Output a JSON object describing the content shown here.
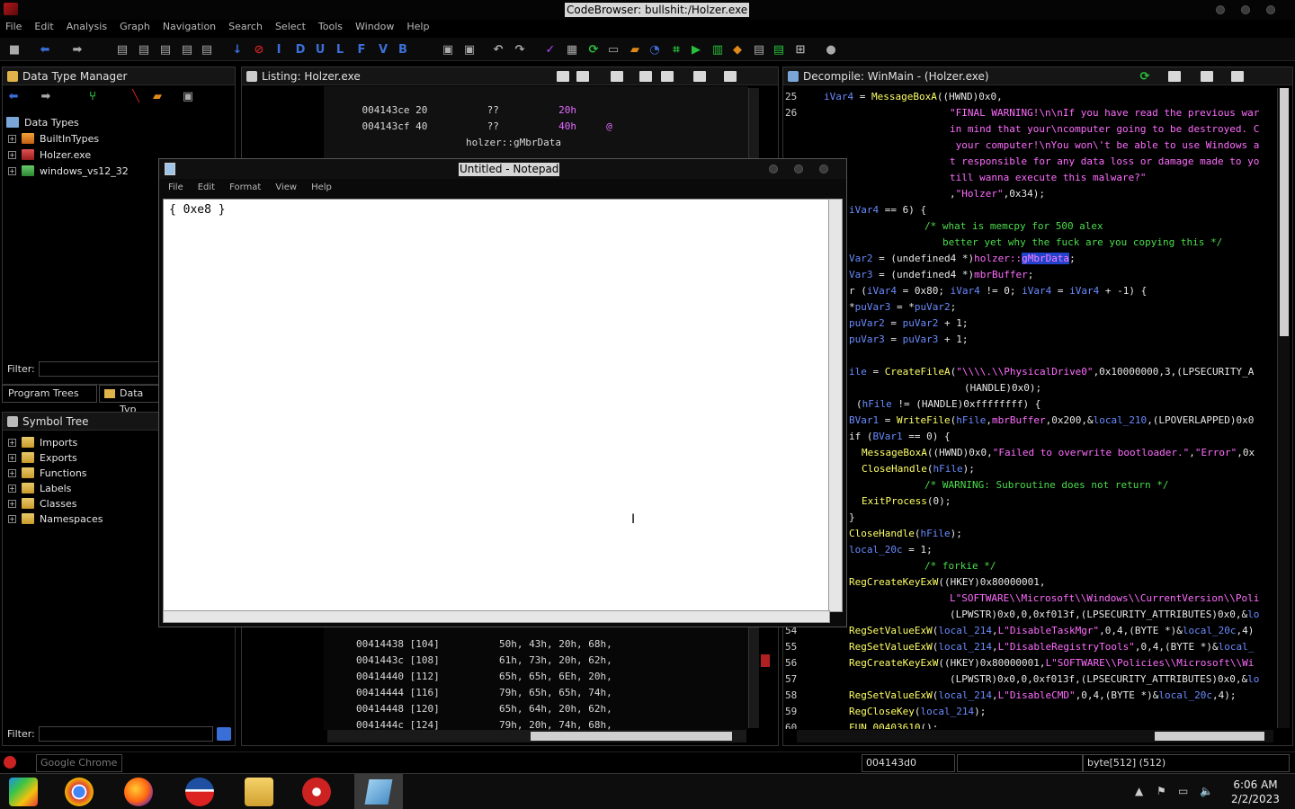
{
  "window": {
    "title": "CodeBrowser: bullshit:/Holzer.exe"
  },
  "menubar": [
    "File",
    "Edit",
    "Analysis",
    "Graph",
    "Navigation",
    "Search",
    "Select",
    "Tools",
    "Window",
    "Help"
  ],
  "toolbar": {
    "letters": [
      "I",
      "D",
      "U",
      "L",
      "F",
      "V",
      "B"
    ]
  },
  "data_type_manager": {
    "title": "Data Type Manager",
    "root": "Data Types",
    "items": [
      "BuiltInTypes",
      "Holzer.exe",
      "windows_vs12_32"
    ],
    "filter_label": "Filter:"
  },
  "tabs": {
    "program_trees": "Program Trees",
    "data_types": "Data Typ"
  },
  "symbol_tree": {
    "title": "Symbol Tree",
    "items": [
      "Imports",
      "Exports",
      "Functions",
      "Labels",
      "Classes",
      "Namespaces"
    ],
    "filter_label": "Filter:"
  },
  "listing": {
    "title": "Listing:  Holzer.exe",
    "top_rows": [
      {
        "addr": "004143ce",
        "byte": "20",
        "mnem": "??",
        "val": "20h",
        "extra": ""
      },
      {
        "addr": "004143cf",
        "byte": "40",
        "mnem": "??",
        "val": "40h",
        "extra": "@"
      }
    ],
    "label": "holzer::gMbrData",
    "bottom_rows": [
      {
        "addr": "00414438",
        "idx": "[104]",
        "vals": "50h, 43h, 20h, 68h,"
      },
      {
        "addr": "0041443c",
        "idx": "[108]",
        "vals": "61h, 73h, 20h, 62h,"
      },
      {
        "addr": "00414440",
        "idx": "[112]",
        "vals": "65h, 65h, 6Eh, 20h,"
      },
      {
        "addr": "00414444",
        "idx": "[116]",
        "vals": "79h, 65h, 65h, 74h,"
      },
      {
        "addr": "00414448",
        "idx": "[120]",
        "vals": "65h, 64h, 20h, 62h,"
      },
      {
        "addr": "0041444c",
        "idx": "[124]",
        "vals": "79h, 20h, 74h, 68h,"
      }
    ]
  },
  "decompile": {
    "title": "Decompile: WinMain - (Holzer.exe)",
    "line_numbers": [
      "25",
      "26",
      "54",
      "55",
      "56",
      "57",
      "58",
      "59",
      "60"
    ]
  },
  "notepad": {
    "title": "Untitled - Notepad",
    "menu": [
      "File",
      "Edit",
      "Format",
      "View",
      "Help"
    ],
    "content": "{ 0xe8 }"
  },
  "statusbar": {
    "chrome_label": "Google Chrome",
    "address": "004143d0",
    "type": "byte[512] (512)"
  },
  "clock": {
    "time": "6:06 AM",
    "date": "2/2/2023"
  }
}
